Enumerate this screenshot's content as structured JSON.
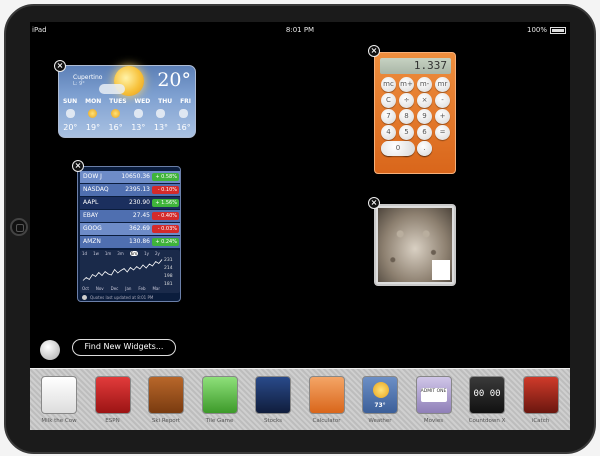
{
  "status": {
    "carrier": "iPad",
    "time": "8:01 PM",
    "battery": "100%"
  },
  "weather": {
    "city": "Cupertino",
    "hilo": "L: 9°",
    "temp": "20°",
    "days": [
      "SUN",
      "MON",
      "TUES",
      "WED",
      "THU",
      "FRI"
    ],
    "icons": [
      "cloudy-icon",
      "sunny-icon",
      "sunny-icon",
      "fog-icon",
      "fog-icon",
      "cloudy-icon"
    ],
    "temps": [
      "20°",
      "19°",
      "16°",
      "13°",
      "13°",
      "16°"
    ]
  },
  "stocks": {
    "rows": [
      {
        "sym": "DOW J",
        "price": "10650.36",
        "chg": "+ 0.58%",
        "dir": "up"
      },
      {
        "sym": "NASDAQ",
        "price": "2395.13",
        "chg": "- 0.10%",
        "dir": "down"
      },
      {
        "sym": "AAPL",
        "price": "230.90",
        "chg": "+ 1.56%",
        "dir": "up"
      },
      {
        "sym": "EBAY",
        "price": "27.45",
        "chg": "- 0.40%",
        "dir": "down"
      },
      {
        "sym": "GOOG",
        "price": "362.69",
        "chg": "- 0.03%",
        "dir": "down"
      },
      {
        "sym": "AMZN",
        "price": "130.86",
        "chg": "+ 0.24%",
        "dir": "up"
      }
    ],
    "ranges": [
      "1d",
      "1w",
      "1m",
      "3m",
      "6m",
      "1y",
      "2y"
    ],
    "selected_range": "6m",
    "y_ticks": [
      "231",
      "214",
      "198",
      "181"
    ],
    "x_ticks": [
      "Oct",
      "Nov",
      "Dec",
      "Jan",
      "Feb",
      "Mar"
    ],
    "footer": "Quotes last updated at 8:01 PM",
    "chart_data": {
      "type": "line",
      "x": [
        "Oct",
        "Nov",
        "Dec",
        "Jan",
        "Feb",
        "Mar"
      ],
      "ylim": [
        181,
        231
      ],
      "series": [
        {
          "values": [
            188,
            194,
            190,
            200,
            196,
            204,
            198,
            206,
            201,
            199,
            210,
            203,
            208,
            212,
            205,
            214,
            209,
            216,
            211,
            219,
            213,
            221,
            217,
            226,
            222,
            230
          ]
        }
      ]
    }
  },
  "calculator": {
    "display": "1.337",
    "keys": [
      "mc",
      "m+",
      "m-",
      "mr",
      "C",
      "÷",
      "×",
      "-",
      "7",
      "8",
      "9",
      "+",
      "4",
      "5",
      "6",
      "=",
      "1",
      "2",
      "3",
      "",
      "0",
      "."
    ]
  },
  "find_widgets": {
    "label": "Find New Widgets..."
  },
  "dock": {
    "items": [
      {
        "label": "Milk the Cow"
      },
      {
        "label": "ESPN"
      },
      {
        "label": "Ski Report"
      },
      {
        "label": "Tile Game"
      },
      {
        "label": "Stocks"
      },
      {
        "label": "Calculator"
      },
      {
        "label": "Weather",
        "badge": "73°"
      },
      {
        "label": "Movies",
        "badge": "ADMIT ONE"
      },
      {
        "label": "Countdown X",
        "badge": "00 00"
      },
      {
        "label": "iCatch"
      }
    ]
  }
}
